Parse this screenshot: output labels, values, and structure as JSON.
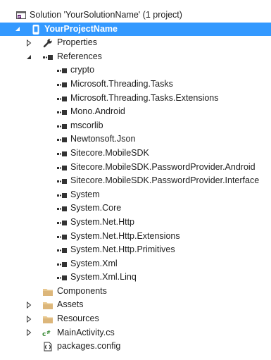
{
  "solution": {
    "label": "Solution 'YourSolutionName' (1 project)"
  },
  "project": {
    "label": "YourProjectName"
  },
  "properties": {
    "label": "Properties"
  },
  "references": {
    "label": "References",
    "items": [
      "crypto",
      "Microsoft.Threading.Tasks",
      "Microsoft.Threading.Tasks.Extensions",
      "Mono.Android",
      "mscorlib",
      "Newtonsoft.Json",
      "Sitecore.MobileSDK",
      "Sitecore.MobileSDK.PasswordProvider.Android",
      "Sitecore.MobileSDK.PasswordProvider.Interface",
      "System",
      "System.Core",
      "System.Net.Http",
      "System.Net.Http.Extensions",
      "System.Net.Http.Primitives",
      "System.Xml",
      "System.Xml.Linq"
    ]
  },
  "components": {
    "label": "Components"
  },
  "assets": {
    "label": "Assets"
  },
  "resources": {
    "label": "Resources"
  },
  "main_activity": {
    "label": "MainActivity.cs"
  },
  "packages_config": {
    "label": "packages.config"
  },
  "colors": {
    "selection": "#3399ff",
    "folder": "#dcb67a",
    "csharp": "#388a34"
  }
}
